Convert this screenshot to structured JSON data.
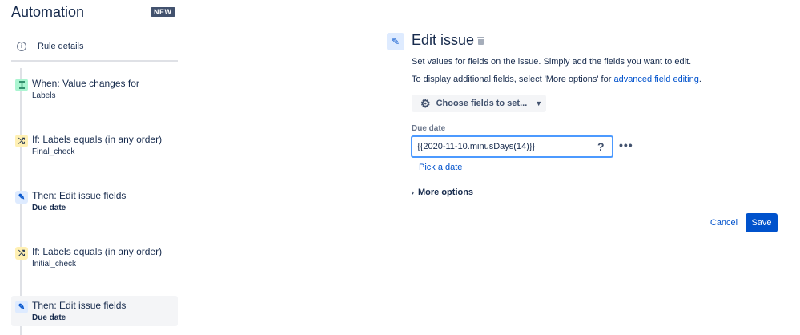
{
  "app": {
    "title": "Automation",
    "badge": "NEW"
  },
  "sidebar": {
    "rule_details": {
      "icon": "info-icon",
      "label": "Rule details"
    },
    "steps": [
      {
        "type": "trigger",
        "icon": "trigger-icon",
        "title": "When: Value changes for",
        "subtitle": "Labels",
        "subtitle_bold": false
      },
      {
        "type": "condition",
        "icon": "shuffle-icon",
        "title": "If: Labels equals (in any order)",
        "subtitle": "Final_check",
        "subtitle_bold": false
      },
      {
        "type": "action",
        "icon": "pencil-icon",
        "title": "Then: Edit issue fields",
        "subtitle": "Due date",
        "subtitle_bold": true
      },
      {
        "type": "condition",
        "icon": "shuffle-icon",
        "title": "If: Labels equals (in any order)",
        "subtitle": "Initial_check",
        "subtitle_bold": false
      },
      {
        "type": "action",
        "icon": "pencil-icon",
        "title": "Then: Edit issue fields",
        "subtitle": "Due date",
        "subtitle_bold": true,
        "selected": true
      }
    ]
  },
  "panel": {
    "title": "Edit issue",
    "description": "Set values for fields on the issue. Simply add the fields you want to edit.",
    "additional_prefix": "To display additional fields, select 'More options' for ",
    "additional_link": "advanced field editing",
    "additional_suffix": ".",
    "choose_fields_label": "Choose fields to set...",
    "due_date": {
      "label": "Due date",
      "value": "{{2020-11-10.minusDays(14)}}",
      "help": "?",
      "more": "•••",
      "pick_date": "Pick a date"
    },
    "more_options_label": "More options",
    "cancel_label": "Cancel",
    "save_label": "Save"
  },
  "colors": {
    "primary": "#0052cc",
    "trigger_bg": "#abf5d1",
    "condition_bg": "#fff0b3",
    "action_bg": "#deebff",
    "selected_bg": "#f4f5f7"
  }
}
